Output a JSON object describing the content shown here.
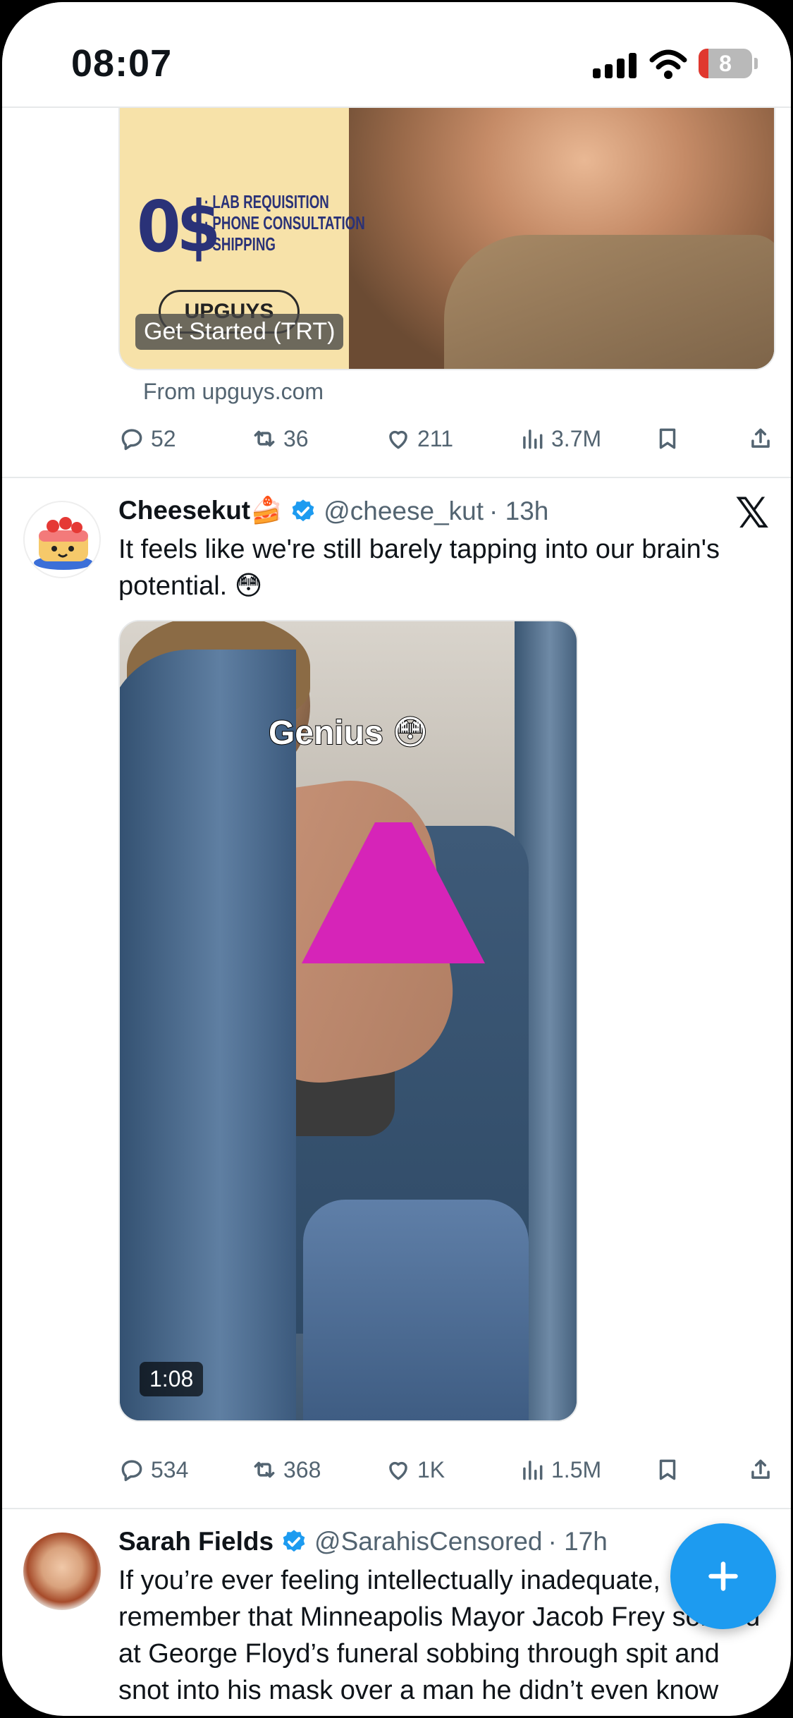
{
  "status_bar": {
    "time": "08:07",
    "battery": "8"
  },
  "ad": {
    "price": "0$",
    "bullets": [
      "· LAB REQUISITION",
      "· PHONE CONSULTATION",
      "· SHIPPING"
    ],
    "logo": "UPGUYS",
    "cta": "Get Started (TRT)",
    "from": "From upguys.com",
    "actions": {
      "replies": "52",
      "reposts": "36",
      "likes": "211",
      "views": "3.7M"
    }
  },
  "tweet1": {
    "name": "Cheesekut🍰",
    "handle": "@cheese_kut",
    "time": "· 13h",
    "text": "It feels like we're still barely tapping into our brain's potential. 😳",
    "video_caption": "Genius 😳",
    "duration": "1:08",
    "actions": {
      "replies": "534",
      "reposts": "368",
      "likes": "1K",
      "views": "1.5M"
    }
  },
  "tweet2": {
    "name": "Sarah Fields",
    "handle": "@SarahisCensored",
    "time": "· 17h",
    "text": "If you’re ever feeling intellectually inadequate, remember that Minneapolis Mayor Jacob Frey sobbed at George Floyd’s funeral sobbing through spit and snot into his mask over a man he didn’t even know from Adam."
  },
  "colors": {
    "accent": "#1d9bf0",
    "secondary_text": "#536471",
    "divider": "#e7e9ea"
  },
  "icons": [
    "reply-icon",
    "repost-icon",
    "like-icon",
    "views-icon",
    "bookmark-icon",
    "share-icon",
    "verified-icon",
    "x-logo-icon",
    "compose-icon"
  ]
}
